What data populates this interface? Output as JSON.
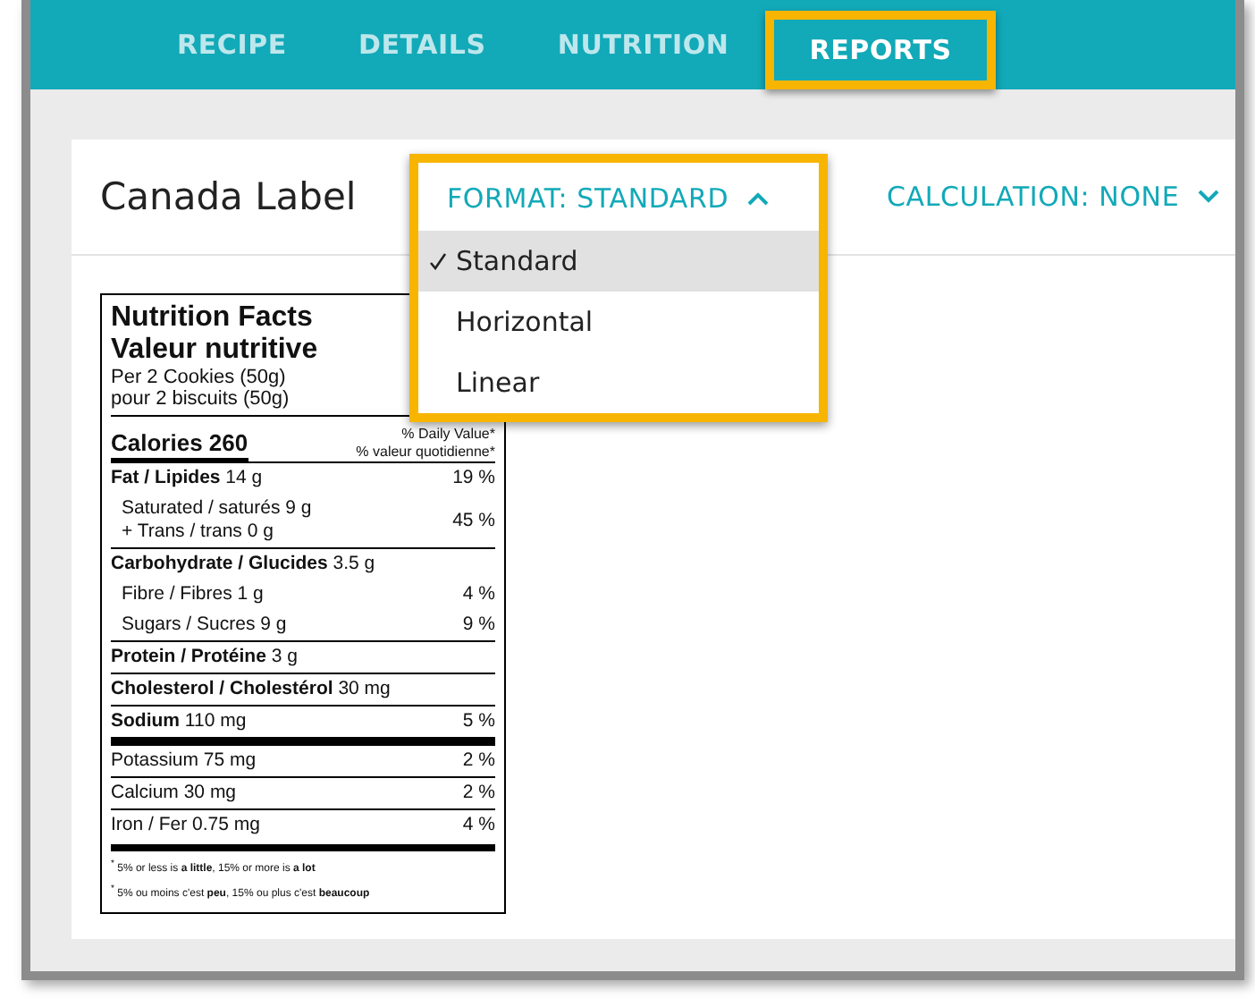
{
  "tabs": [
    {
      "label": "RECIPE",
      "selected": false
    },
    {
      "label": "DETAILS",
      "selected": false
    },
    {
      "label": "NUTRITION",
      "selected": false
    },
    {
      "label": "REPORTS",
      "selected": true
    }
  ],
  "card": {
    "title": "Canada Label",
    "format": {
      "label": "FORMAT: STANDARD",
      "expanded": true,
      "options": [
        {
          "label": "Standard",
          "selected": true
        },
        {
          "label": "Horizontal",
          "selected": false
        },
        {
          "label": "Linear",
          "selected": false
        }
      ]
    },
    "calculation": {
      "label": "CALCULATION: NONE",
      "expanded": false
    }
  },
  "label": {
    "title": "Nutrition Facts",
    "title_fr": "Valeur nutritive",
    "serving": "Per 2 Cookies (50g)",
    "serving_fr": "pour 2 biscuits (50g)",
    "calories": "Calories 260",
    "dv_heading": "% Daily Value*",
    "dv_heading_fr": "% valeur quotidienne*",
    "rows": [
      {
        "kind": "nutrient",
        "text": "**Fat / Lipides** 14 g",
        "dv": "19 %",
        "children": [
          {
            "lines": [
              "Saturated / saturés 9 g",
              "+ Trans / trans 0 g"
            ],
            "dv": "45 %"
          }
        ]
      },
      {
        "kind": "nutrient",
        "text": "**Carbohydrate / Glucides** 3.5 g",
        "children": [
          {
            "lines": [
              "Fibre / Fibres 1 g"
            ],
            "dv": "4 %"
          },
          {
            "lines": [
              "Sugars / Sucres 9 g"
            ],
            "dv": "9 %"
          }
        ]
      },
      {
        "kind": "nutrient",
        "text": "**Protein / Protéine** 3 g"
      },
      {
        "kind": "nutrient",
        "text": "**Cholesterol / Cholestérol** 30 mg"
      },
      {
        "kind": "nutrient",
        "text": "**Sodium** 110 mg",
        "dv": "5 %"
      },
      {
        "kind": "mineral",
        "text": "Potassium 75 mg",
        "dv": "2 %"
      },
      {
        "kind": "mineral",
        "text": "Calcium 30 mg",
        "dv": "2 %"
      },
      {
        "kind": "mineral",
        "text": "Iron / Fer 0.75 mg",
        "dv": "4 %"
      }
    ],
    "footnotes": [
      "$^{*}$ 5% or less is **a little**, 15% or more is **a lot**",
      "$^{*}$ 5% ou moins c'est **peu**, 15% ou plus c'est **beaucoup**"
    ]
  }
}
